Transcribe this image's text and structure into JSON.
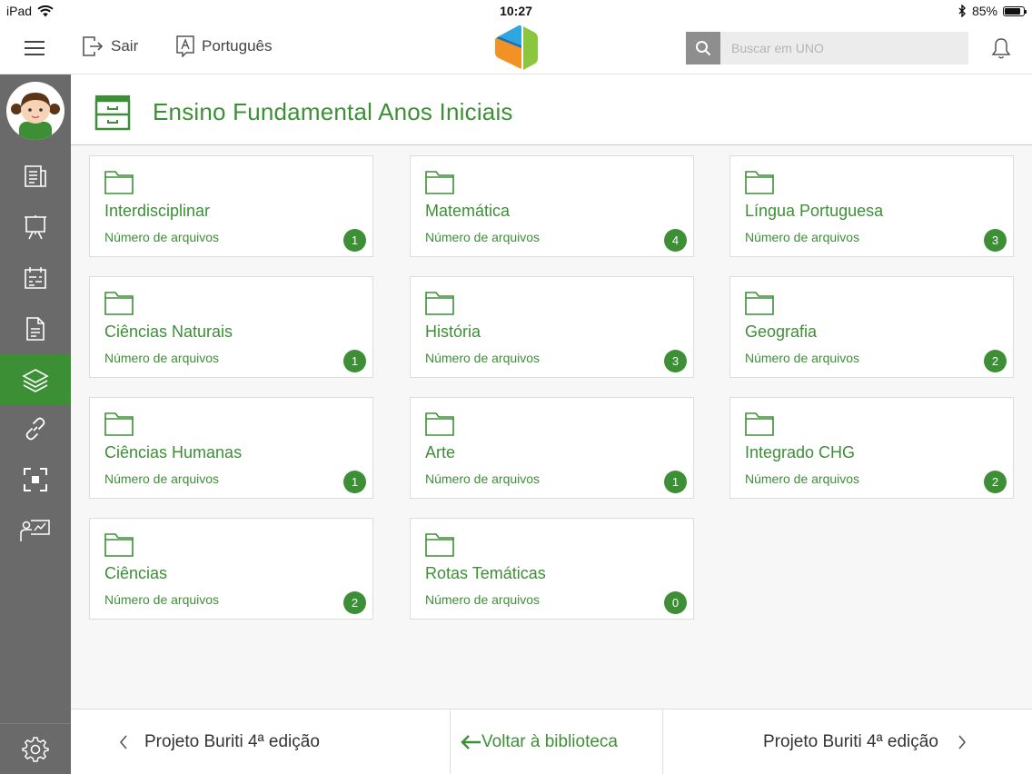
{
  "status_bar": {
    "device": "iPad",
    "time": "10:27",
    "battery": "85%",
    "battery_level": 0.85
  },
  "header": {
    "logout_label": "Sair",
    "language_label": "Português",
    "search_placeholder": "Buscar em UNO"
  },
  "page": {
    "title": "Ensino Fundamental Anos Iniciais"
  },
  "cards": [
    {
      "title": "Interdisciplinar",
      "subtitle": "Número de arquivos",
      "count": "1"
    },
    {
      "title": "Matemática",
      "subtitle": "Número de arquivos",
      "count": "4"
    },
    {
      "title": "Língua Portuguesa",
      "subtitle": "Número de arquivos",
      "count": "3"
    },
    {
      "title": "Ciências Naturais",
      "subtitle": "Número de arquivos",
      "count": "1"
    },
    {
      "title": "História",
      "subtitle": "Número de arquivos",
      "count": "3"
    },
    {
      "title": "Geografia",
      "subtitle": "Número de arquivos",
      "count": "2"
    },
    {
      "title": "Ciências Humanas",
      "subtitle": "Número de arquivos",
      "count": "1"
    },
    {
      "title": "Arte",
      "subtitle": "Número de arquivos",
      "count": "1"
    },
    {
      "title": "Integrado CHG",
      "subtitle": "Número de arquivos",
      "count": "2"
    },
    {
      "title": "Ciências",
      "subtitle": "Número de arquivos",
      "count": "2"
    },
    {
      "title": "Rotas Temáticas",
      "subtitle": "Número de arquivos",
      "count": "0"
    }
  ],
  "sidebar": {
    "items": [
      {
        "icon": "newspaper-icon"
      },
      {
        "icon": "presentation-board-icon"
      },
      {
        "icon": "planner-icon"
      },
      {
        "icon": "document-icon"
      },
      {
        "icon": "layers-icon",
        "active": true
      },
      {
        "icon": "link-icon"
      },
      {
        "icon": "scan-focus-icon"
      },
      {
        "icon": "teacher-board-icon"
      }
    ],
    "bottom_icon": "gear-icon"
  },
  "bottom_nav": {
    "prev_label": "Projeto Buriti 4ª edição",
    "back_label": "Voltar à biblioteca",
    "next_label": "Projeto Buriti 4ª edição"
  },
  "colors": {
    "accent": "#3d8f36",
    "sidebar": "#6a6a6a"
  }
}
